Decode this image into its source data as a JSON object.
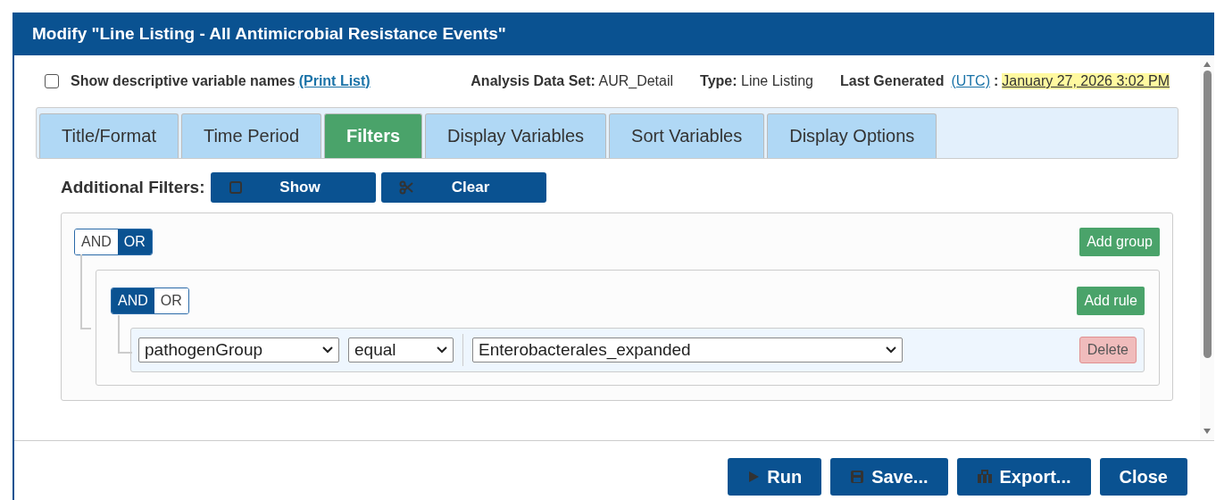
{
  "dialog": {
    "title": "Modify \"Line Listing - All Antimicrobial Resistance Events\""
  },
  "options": {
    "checkbox_label": "Show descriptive variable names",
    "checked": false,
    "link": "(Print List)"
  },
  "info": [
    {
      "label": "Analysis Data Set:",
      "value": "AUR_Detail"
    },
    {
      "label": "Type:",
      "value": "Line Listing"
    }
  ],
  "last_generated": {
    "label": "Last Generated",
    "link": "(UTC)",
    "separator": ":",
    "value": "January 27, 2026 3:02 PM"
  },
  "tabs": [
    {
      "label": "Title/Format",
      "selected": false
    },
    {
      "label": "Time Period",
      "selected": false
    },
    {
      "label": "Filters",
      "selected": true
    },
    {
      "label": "Display Variables",
      "selected": false
    },
    {
      "label": "Sort Variables",
      "selected": false
    },
    {
      "label": "Display Options",
      "selected": false
    }
  ],
  "additional_filters": {
    "label": "Additional Filters:",
    "buttons": [
      {
        "label": "Show",
        "kind": "show"
      },
      {
        "label": "Clear",
        "kind": "clear"
      }
    ]
  },
  "query": {
    "conditions": [
      {
        "label": "AND",
        "selected": false
      },
      {
        "label": "OR",
        "selected": true
      }
    ],
    "add_button": "Add group",
    "groups": [
      {
        "conditions": [
          {
            "label": "AND",
            "selected": true
          },
          {
            "label": "OR",
            "selected": false
          }
        ],
        "add_button": "Add rule",
        "rules": [
          {
            "field": "pathogenGroup",
            "operator": "equal",
            "value": "Enterobacterales_expanded",
            "delete": "Delete"
          }
        ]
      }
    ]
  },
  "footer_buttons": [
    {
      "label": "Run",
      "kind": "run"
    },
    {
      "label": "Save...",
      "kind": "save"
    },
    {
      "label": "Export...",
      "kind": "export"
    },
    {
      "label": "Close",
      "kind": "close"
    }
  ]
}
